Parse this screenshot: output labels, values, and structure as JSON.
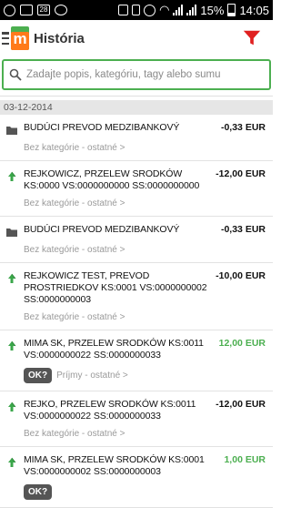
{
  "statusbar": {
    "battery": "15%",
    "time": "14:05",
    "calendar_day": "28"
  },
  "appbar": {
    "logo_letter": "m",
    "title": "História"
  },
  "search": {
    "placeholder": "Zadajte popis, kategóriu, tagy alebo sumu",
    "value": ""
  },
  "date_header": "03-12-2014",
  "transactions": [
    {
      "type": "folder",
      "name": "BUDÚCI PREVOD MEDZIBANKOVÝ",
      "amount": "-0,33 EUR",
      "positive": false,
      "category": "Bez kategórie - ostatné >",
      "ok": ""
    },
    {
      "type": "transfer",
      "name": "REJKOWICZ, PRZELEW SRODKÓW KS:0000 VS:0000000000 SS:0000000000",
      "amount": "-12,00 EUR",
      "positive": false,
      "category": "Bez kategórie - ostatné >",
      "ok": ""
    },
    {
      "type": "folder",
      "name": "BUDÚCI PREVOD MEDZIBANKOVÝ",
      "amount": "-0,33 EUR",
      "positive": false,
      "category": "Bez kategórie - ostatné >",
      "ok": ""
    },
    {
      "type": "transfer",
      "name": "REJKOWICZ TEST, PREVOD PROSTRIEDKOV KS:0001 VS:0000000002 SS:0000000003",
      "amount": "-10,00 EUR",
      "positive": false,
      "category": "Bez kategórie - ostatné >",
      "ok": ""
    },
    {
      "type": "transfer",
      "name": "MIMA SK, PRZELEW SRODKÓW KS:0011 VS:0000000022 SS:0000000033",
      "amount": "12,00 EUR",
      "positive": true,
      "category": "Príjmy - ostatné >",
      "ok": "OK?"
    },
    {
      "type": "transfer",
      "name": "REJKO, PRZELEW SRODKÓW KS:0011 VS:0000000022 SS:0000000033",
      "amount": "-12,00 EUR",
      "positive": false,
      "category": "Bez kategórie - ostatné >",
      "ok": ""
    },
    {
      "type": "transfer",
      "name": "MIMA SK, PRZELEW SRODKÓW KS:0001 VS:0000000002 SS:0000000003",
      "amount": "1,00 EUR",
      "positive": true,
      "category": "",
      "ok": "OK?"
    }
  ]
}
